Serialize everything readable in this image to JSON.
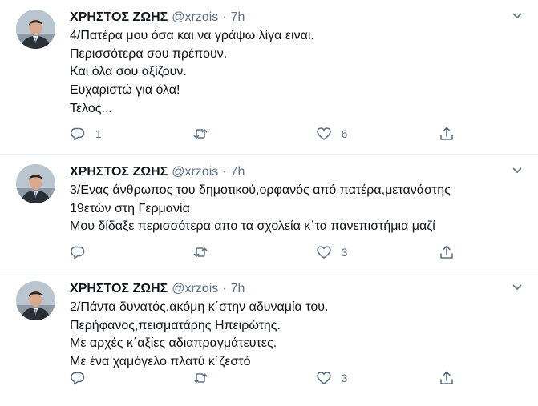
{
  "tweets": [
    {
      "name": "ΧΡΗΣΤΟΣ ΖΩΗΣ",
      "handle": "@xrzois",
      "separator": "·",
      "time": "7h",
      "lines": [
        "4/Πατέρα μου όσα και να γράψω λίγα ειναι.",
        "Περισσότερα σου πρέπουν.",
        "Και όλα σου αξίζουν.",
        "Ευχαριστώ για όλα!",
        "Τέλος..."
      ],
      "replies": "1",
      "retweets": "",
      "likes": "6"
    },
    {
      "name": "ΧΡΗΣΤΟΣ ΖΩΗΣ",
      "handle": "@xrzois",
      "separator": "·",
      "time": "7h",
      "lines": [
        "3/Ενας άνθρωπος του δημοτικού,ορφανός από πατέρα,μετανάστης",
        "19ετών στη Γερμανία",
        "Μου δίδαξε περισσότερα απο τα σχολεία κ΄τα πανεπιστήμια μαζί"
      ],
      "replies": "",
      "retweets": "",
      "likes": "3"
    },
    {
      "name": "ΧΡΗΣΤΟΣ ΖΩΗΣ",
      "handle": "@xrzois",
      "separator": "·",
      "time": "7h",
      "lines": [
        "2/Πάντα δυνατός,ακόμη κ΄στην αδυναμία του.",
        "Περήφανος,πεισματάρης Ηπειρώτης.",
        "Με αρχές κ΄αξίες αδιαπραγμάτευτες.",
        "Με ένα χαμόγελο πλατύ κ΄ζεστό"
      ],
      "replies": "",
      "retweets": "",
      "likes": "3"
    }
  ],
  "icons": {
    "reply": "reply-icon",
    "retweet": "retweet-icon",
    "like": "heart-icon",
    "share": "share-icon",
    "more": "chevron-down-icon"
  },
  "colors": {
    "text": "#0f1419",
    "muted": "#5b7083",
    "border": "#e6ecf0"
  }
}
